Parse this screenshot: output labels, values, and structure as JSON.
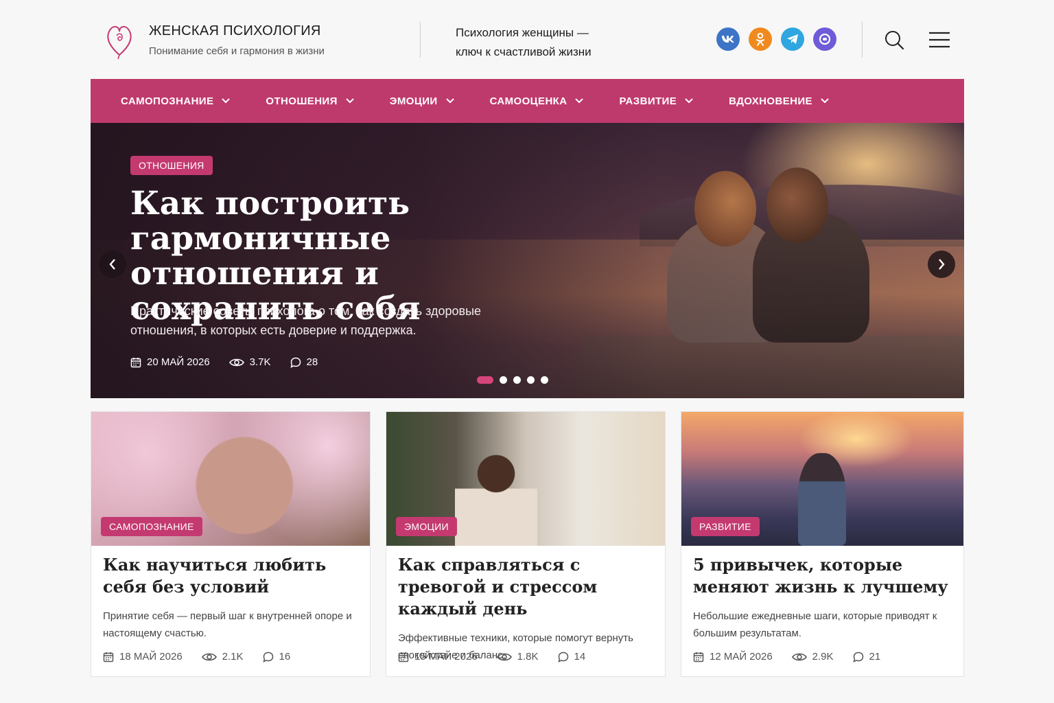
{
  "header": {
    "brand_title": "ЖЕНСКАЯ ПСИХОЛОГИЯ",
    "brand_subtitle": "Понимание себя и гармония в жизни",
    "slogan_line1": "Психология женщины —",
    "slogan_line2": "ключ к счастливой жизни",
    "socials": [
      "vk-icon",
      "odnoklassniki-icon",
      "telegram-icon",
      "zen-icon"
    ],
    "accent_color": "#bf3a6c"
  },
  "nav": {
    "items": [
      {
        "label": "САМОПОЗНАНИЕ"
      },
      {
        "label": "ОТНОШЕНИЯ"
      },
      {
        "label": "ЭМОЦИИ"
      },
      {
        "label": "САМООЦЕНКА"
      },
      {
        "label": "РАЗВИТИЕ"
      },
      {
        "label": "ВДОХНОВЕНИЕ"
      }
    ]
  },
  "hero": {
    "category": "ОТНОШЕНИЯ",
    "title": "Как построить гармоничные отношения и сохранить себя",
    "description": "Практические советы психолога о том, как создать здоровые отношения, в которых есть доверие и поддержка.",
    "date": "20 МАЙ 2026",
    "views": "3.7K",
    "comments": "28",
    "slides_total": 5,
    "active_slide": 1
  },
  "cards": [
    {
      "category": "САМОПОЗНАНИЕ",
      "title": "Как научиться любить себя без условий",
      "description": "Принятие себя — первый шаг к внутренней опоре и настоящему счастью.",
      "date": "18 МАЙ 2026",
      "views": "2.1K",
      "comments": "16"
    },
    {
      "category": "ЭМОЦИИ",
      "title": "Как справляться с тревогой и стрессом каждый день",
      "description": "Эффективные техники, которые помогут вернуть спокойствие и баланс.",
      "date": "15 МАЙ 2026",
      "views": "1.8K",
      "comments": "14"
    },
    {
      "category": "РАЗВИТИЕ",
      "title": "5 привычек, которые меняют жизнь к лучшему",
      "description": "Небольшие ежедневные шаги, которые приводят к большим результатам.",
      "date": "12 МАЙ 2026",
      "views": "2.9K",
      "comments": "21"
    }
  ]
}
